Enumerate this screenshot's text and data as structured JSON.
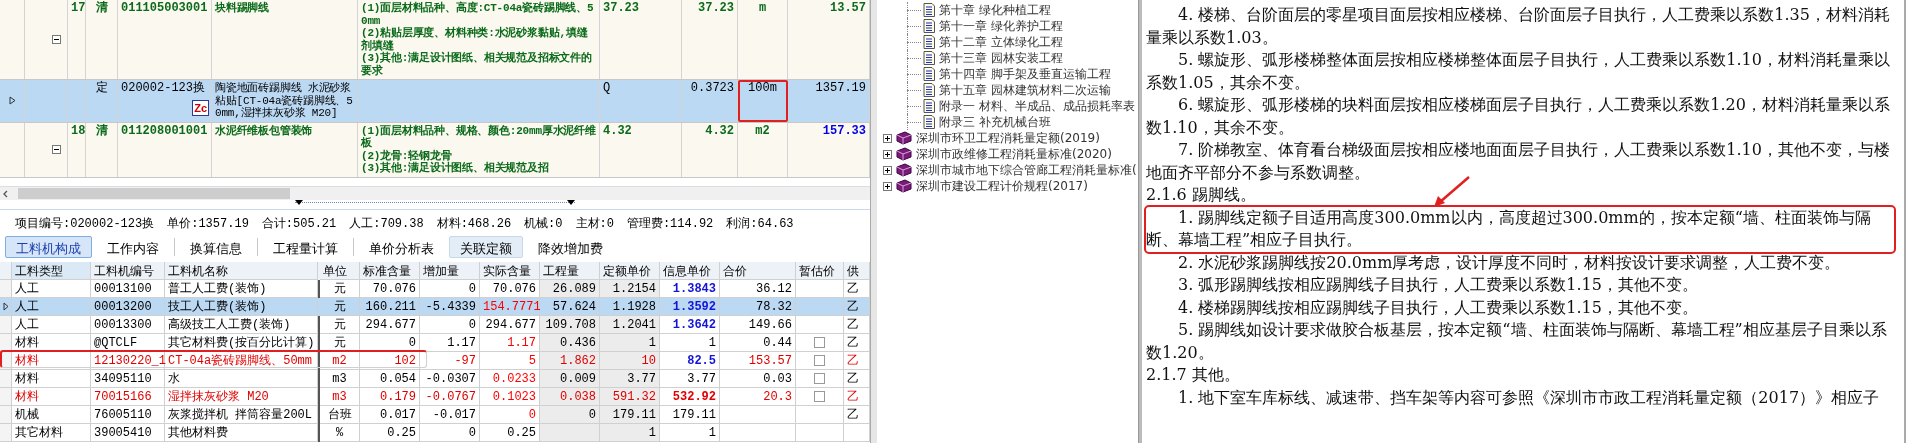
{
  "quota_grid": {
    "rows": [
      {
        "kind": "bill",
        "number": "17",
        "type": "清",
        "code": "011105003001",
        "name": "块料踢脚线",
        "features": [
          "(1)面层材料品种、高度:CT-04a瓷砖踢脚线、50mm",
          "(2)粘贴层厚度、材料种类:水泥砂浆黏贴,填缝剂填缝",
          "(3)其他:满足设计图纸、相关规范及招标文件的要求"
        ],
        "expression": "37.23",
        "quantity": "37.23",
        "unit": "m",
        "price": "13.57",
        "price_highlight": false,
        "expanded": true,
        "selected": false
      },
      {
        "kind": "quota",
        "type": "定",
        "code": "020002-123换",
        "tag": "Zc",
        "name": "陶瓷地面砖踢脚线 水泥砂浆粘贴[CT-04a瓷砖踢脚线、50mm,湿拌抹灰砂浆 M20]",
        "expression": "Q",
        "quantity": "0.3723",
        "unit": "100m",
        "unit_marked": true,
        "price": "1357.19",
        "selected": true
      },
      {
        "kind": "bill",
        "number": "18",
        "type": "清",
        "code": "011208001001",
        "name": "水泥纤维板包管装饰",
        "features": [
          "(1)面层材料品种、规格、颜色:20mm厚水泥纤维板",
          "(2)龙骨:轻钢龙骨",
          "(3)其他:满足设计图纸、相关规范及招"
        ],
        "expression": "4.32",
        "quantity": "4.32",
        "unit": "m2",
        "price": "157.33",
        "price_highlight": true,
        "expanded": true,
        "selected": false
      }
    ]
  },
  "summary": [
    "项目编号:020002-123换",
    "单价:1357.19",
    "合计:505.21",
    "人工:709.38",
    "材料:468.26",
    "机械:0",
    "主材:0",
    "管理费:114.92",
    "利润:64.63"
  ],
  "tabs": [
    {
      "label": "工料机构成",
      "selected": true,
      "hover": false
    },
    {
      "label": "工作内容",
      "selected": false,
      "hover": false
    },
    {
      "label": "换算信息",
      "selected": false,
      "hover": false
    },
    {
      "label": "工程量计算",
      "selected": false,
      "hover": false
    },
    {
      "label": "单价分析表",
      "selected": false,
      "hover": false
    },
    {
      "label": "关联定额",
      "selected": false,
      "hover": true
    },
    {
      "label": "降效增加费",
      "selected": false,
      "hover": false
    }
  ],
  "resource_grid": {
    "columns": [
      "工料类型",
      "工料机编号",
      "工料机名称",
      "单位",
      "标准含量",
      "增加量",
      "实际含量",
      "工程量",
      "定额单价",
      "信息单价",
      "合价",
      "暂估价",
      "供"
    ],
    "rows": [
      {
        "type": "人工",
        "code": "00013100",
        "name": "普工人工费(装饰)",
        "unit": "元",
        "standard": "70.076",
        "added": "0",
        "actual": "70.076",
        "actual_red": false,
        "quantity": "26.089",
        "quota_price": "1.2154",
        "info_price": "1.3843",
        "info_blue": true,
        "info_bold": true,
        "total": "36.12",
        "supplier": "乙",
        "selected": false,
        "red": false,
        "marked": false
      },
      {
        "type": "人工",
        "code": "00013200",
        "name": "技工人工费(装饰)",
        "unit": "元",
        "standard": "160.211",
        "added": "-5.4339",
        "actual": "154.7771",
        "actual_red": true,
        "quantity": "57.624",
        "quota_price": "1.1928",
        "info_price": "1.3592",
        "info_blue": true,
        "info_bold": true,
        "total": "78.32",
        "supplier": "乙",
        "selected": true,
        "red": false,
        "marked": false
      },
      {
        "type": "人工",
        "code": "00013300",
        "name": "高级技工人工费(装饰)",
        "unit": "元",
        "standard": "294.677",
        "added": "0",
        "actual": "294.677",
        "actual_red": false,
        "quantity": "109.708",
        "quota_price": "1.2041",
        "info_price": "1.3642",
        "info_blue": true,
        "info_bold": true,
        "total": "149.66",
        "supplier": "乙",
        "selected": false,
        "red": false,
        "marked": false
      },
      {
        "type": "材料",
        "code": "@QTCLF",
        "name": "其它材料费(按百分比计算)",
        "unit": "元",
        "standard": "0",
        "added": "1.17",
        "actual": "1.17",
        "actual_red": true,
        "quantity": "0.436",
        "quota_price": "1",
        "info_price": "1",
        "info_blue": false,
        "info_bold": false,
        "total": "0.44",
        "estimate_checked": false,
        "supplier": "乙",
        "selected": false,
        "red": false,
        "marked": false
      },
      {
        "type": "材料",
        "code": "12130220_1",
        "name": "CT-04a瓷砖踢脚线、50mm",
        "unit": "m2",
        "standard": "102",
        "added": "-97",
        "actual": "5",
        "actual_red": true,
        "quantity": "1.862",
        "quota_price": "10",
        "info_price": "82.5",
        "info_blue": true,
        "info_bold": true,
        "total": "153.57",
        "estimate_checked": false,
        "supplier": "乙",
        "selected": false,
        "red": true,
        "marked": true
      },
      {
        "type": "材料",
        "code": "34095110",
        "name": "水",
        "unit": "m3",
        "standard": "0.054",
        "added": "-0.0307",
        "actual": "0.0233",
        "actual_red": true,
        "quantity": "0.009",
        "quota_price": "3.77",
        "info_price": "3.77",
        "info_blue": false,
        "info_bold": false,
        "total": "0.03",
        "estimate_checked": false,
        "supplier": "乙",
        "selected": false,
        "red": false,
        "marked": false
      },
      {
        "type": "材料",
        "code": "70015166",
        "name": "湿拌抹灰砂浆 M20",
        "unit": "m3",
        "standard": "0.179",
        "added": "-0.0767",
        "actual": "0.1023",
        "actual_red": true,
        "quantity": "0.038",
        "quota_price": "591.32",
        "info_price": "532.92",
        "info_blue": false,
        "info_bold": true,
        "total": "20.3",
        "estimate_checked": false,
        "supplier": "乙",
        "selected": false,
        "red": true,
        "marked": false
      },
      {
        "type": "机械",
        "code": "76005110",
        "name": "灰浆搅拌机 拌筒容量200L",
        "unit": "台班",
        "standard": "0.017",
        "added": "-0.017",
        "actual": "0",
        "actual_red": true,
        "quantity": "0",
        "quota_price": "179.11",
        "info_price": "179.11",
        "info_blue": false,
        "info_bold": false,
        "supplier": "乙",
        "selected": false,
        "red": false,
        "marked": false
      },
      {
        "type": "其它材料",
        "code": "39005410",
        "name": "其他材料费",
        "unit": "%",
        "standard": "0.25",
        "added": "0",
        "actual": "0.25",
        "actual_red": false,
        "quota_price": "1",
        "info_price": "1",
        "info_blue": false,
        "info_bold": false,
        "selected": false,
        "red": false,
        "marked": false
      }
    ]
  },
  "tree": {
    "items": [
      {
        "kind": "page",
        "label": "第十章 绿化种植工程"
      },
      {
        "kind": "page",
        "label": "第十一章 绿化养护工程"
      },
      {
        "kind": "page",
        "label": "第十二章 立体绿化工程"
      },
      {
        "kind": "page",
        "label": "第十三章 园林安装工程"
      },
      {
        "kind": "page",
        "label": "第十四章 脚手架及垂直运输工程"
      },
      {
        "kind": "page",
        "label": "第十五章 园林建筑材料二次运输"
      },
      {
        "kind": "page",
        "label": "附录一 材料、半成品、成品损耗率表"
      },
      {
        "kind": "page",
        "label": "附录三 补充机械台班"
      },
      {
        "kind": "book",
        "label": "深圳市环卫工程消耗量定额(2019)",
        "expanded": false
      },
      {
        "kind": "book",
        "label": "深圳市政维修工程消耗量标准(2020)",
        "expanded": false
      },
      {
        "kind": "book",
        "label": "深圳市城市地下综合管廊工程消耗量标准(",
        "expanded": false
      },
      {
        "kind": "book",
        "label": "深圳市建设工程计价规程(2017)",
        "expanded": false
      }
    ]
  },
  "document": {
    "paragraphs": [
      {
        "kind": "item",
        "text": "4. 楼梯、台阶面层的零星项目面层按相应楼梯、台阶面层子目执行，人工费乘以系数1.35，材料消耗量乘以系数1.03。",
        "marked": false
      },
      {
        "kind": "item",
        "text": "5. 螺旋形、弧形楼梯整体面层按相应楼梯整体面层子目执行，人工费乘以系数1.10，材料消耗量乘以系数1.05，其余不变。",
        "marked": false
      },
      {
        "kind": "item",
        "text": "6. 螺旋形、弧形楼梯的块料面层按相应楼梯面层子目执行，人工费乘以系数1.20，材料消耗量乘以系数1.10，其余不变。",
        "marked": false
      },
      {
        "kind": "item",
        "text": "7. 阶梯教室、体育看台梯级面层按相应楼地面面层子目执行，人工费乘以系数1.10，其他不变，与楼地面齐平部分不参与系数调整。",
        "marked": false
      },
      {
        "kind": "heading",
        "text": "2.1.6  踢脚线。",
        "marked": false
      },
      {
        "kind": "item",
        "text": "1. 踢脚线定额子目适用高度300.0mm以内，高度超过300.0mm的，按本定额“墙、柱面装饰与隔断、幕墙工程”相应子目执行。",
        "marked": true
      },
      {
        "kind": "item",
        "text": "2. 水泥砂浆踢脚线按20.0mm厚考虑，设计厚度不同时，材料按设计要求调整，人工费不变。",
        "marked": false
      },
      {
        "kind": "item",
        "text": "3. 弧形踢脚线按相应踢脚线子目执行，人工费乘以系数1.15，其他不变。",
        "marked": false
      },
      {
        "kind": "item",
        "text": "4. 楼梯踢脚线按相应踢脚线子目执行，人工费乘以系数1.15，其他不变。",
        "marked": false
      },
      {
        "kind": "item",
        "text": "5. 踢脚线如设计要求做胶合板基层，按本定额“墙、柱面装饰与隔断、幕墙工程”相应基层子目乘以系数1.20。",
        "marked": false
      },
      {
        "kind": "heading",
        "text": "2.1.7  其他。",
        "marked": false
      },
      {
        "kind": "item",
        "text": "1. 地下室车库标线、减速带、挡车架等内容可参照《深圳市市政工程消耗量定额（2017）》相应子",
        "marked": false
      }
    ]
  }
}
